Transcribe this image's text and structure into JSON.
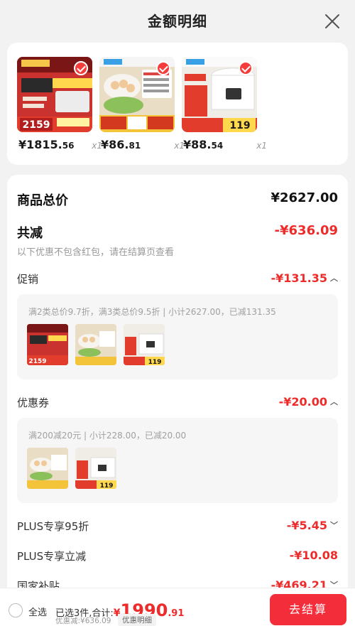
{
  "header": {
    "title": "金额明细",
    "close_icon": "close-icon"
  },
  "products": [
    {
      "price_int": "¥1815.",
      "price_dec": "56",
      "qty": "x1",
      "thumb_text": "2159"
    },
    {
      "price_int": "¥86.",
      "price_dec": "81",
      "qty": "x1",
      "thumb_text": ""
    },
    {
      "price_int": "¥88.",
      "price_dec": "54",
      "qty": "x1",
      "thumb_text": "119"
    }
  ],
  "detail": {
    "total_label": "商品总价",
    "total_value": "¥2627.00",
    "discount_label": "共减",
    "discount_value": "-¥636.09",
    "note": "以下优惠不包含红包，请在结算页查看",
    "promo": {
      "label": "促销",
      "value": "-¥131.35",
      "desc": "满2类总价9.7折，满3类总价9.5折 | 小计2627.00，已减131.35",
      "thumbs": [
        "2159",
        "",
        "119"
      ]
    },
    "coupon": {
      "label": "优惠券",
      "value": "-¥20.00",
      "desc": "满200减20元 | 小计228.00，已减20.00",
      "thumbs": [
        "",
        "119"
      ]
    },
    "plus95": {
      "label": "PLUS专享95折",
      "value": "-¥5.45"
    },
    "plus_direct": {
      "label": "PLUS专享立减",
      "value": "-¥10.08"
    },
    "subsidy": {
      "label": "国家补贴",
      "value": "-¥469.21"
    }
  },
  "bottom": {
    "select_all": "全选",
    "summary_prefix": "已选3件,合计:",
    "currency": "¥",
    "total_int": "1990",
    "total_dec": ".91",
    "saved": "优惠减:¥636.09",
    "detail_tag": "优惠明细",
    "checkout": "去结算"
  },
  "colors": {
    "accent": "#ee2b2b",
    "checkout_bg": "#f42d3a"
  }
}
